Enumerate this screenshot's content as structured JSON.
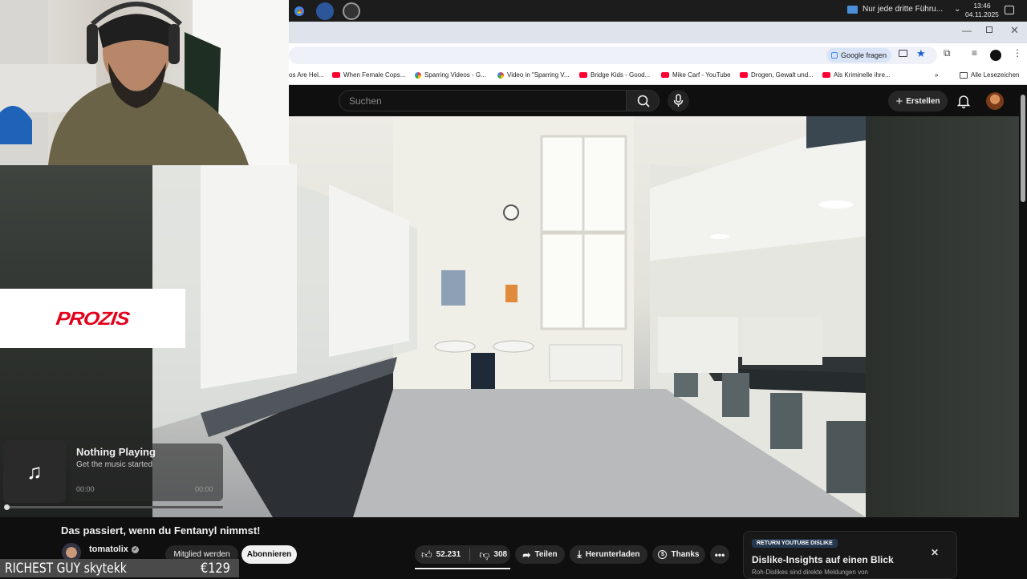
{
  "taskbar": {
    "notice": "Nur jede dritte Führu...",
    "time": "13:46",
    "date": "04.11.2025"
  },
  "omnibar": {
    "google_ask": "Google fragen"
  },
  "bookmarks": {
    "items": [
      {
        "label": "os Are Hel...",
        "icon": "globe-icon"
      },
      {
        "label": "When Female Cops...",
        "icon": "youtube-icon"
      },
      {
        "label": "Sparring Videos - G...",
        "icon": "google-icon"
      },
      {
        "label": "Video in \"Sparring V...",
        "icon": "google-icon"
      },
      {
        "label": "Bridge Kids - Good...",
        "icon": "youtube-icon"
      },
      {
        "label": "Mike Carf - YouTube",
        "icon": "youtube-icon"
      },
      {
        "label": "Drogen, Gewalt und...",
        "icon": "youtube-icon"
      },
      {
        "label": "Als Kriminelle ihre...",
        "icon": "youtube-icon"
      }
    ],
    "all_bookmarks": "Alle Lesezeichen"
  },
  "youtube": {
    "search_placeholder": "Suchen",
    "create_label": "Erstellen",
    "video_title": "Das passiert, wenn du Fentanyl nimmst!",
    "channel": "tomatolix",
    "join_label": "Mitglied werden",
    "subscribe_label": "Abonnieren",
    "likes": "52.231",
    "dislikes": "308",
    "share_label": "Teilen",
    "download_label": "Herunterladen",
    "thanks_label": "Thanks"
  },
  "ryd": {
    "badge": "RETURN YOUTUBE DISLIKE",
    "title": "Dislike-Insights auf einen Blick",
    "subtitle": "Roh-Dislikes sind direkte Meldungen von"
  },
  "overlay": {
    "sponsor": "PROZIS",
    "music_title": "Nothing Playing",
    "music_sub": "Get the music started",
    "time_start": "00:00",
    "time_end": "00:00",
    "music_progress": 0,
    "donor": "RICHEST GUY skytekk",
    "amount": "€129"
  },
  "colors": {
    "youtube_red": "#ff0033",
    "prozis_red": "#e3001b",
    "yt_bg": "#0f0f0f"
  }
}
